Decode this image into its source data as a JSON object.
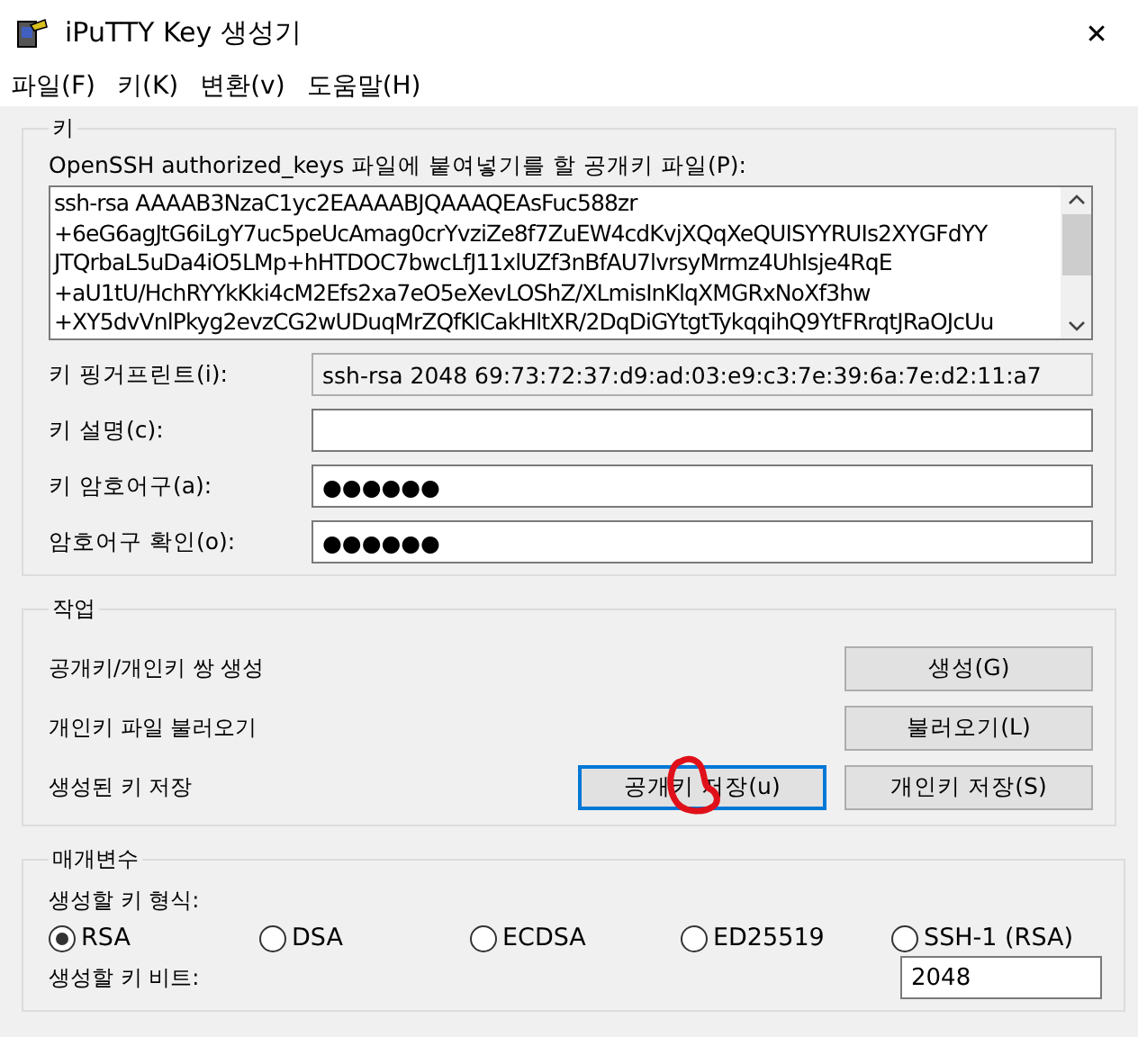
{
  "window": {
    "title": "iPuTTY Key 생성기",
    "close": "✕"
  },
  "menu": [
    "파일(F)",
    "키(K)",
    "변환(v)",
    "도움말(H)"
  ],
  "key_group": {
    "title": "키",
    "public_key_label": "OpenSSH authorized_keys 파일에 붙여넣기를 할 공개키 파일(P):",
    "public_key_lines": [
      "ssh-rsa AAAAB3NzaC1yc2EAAAABJQAAAQEAsFuc588zr",
      "+6eG6agJtG6iLgY7uc5peUcAmag0crYvziZe8f7ZuEW4cdKvjXQqXeQUISYYRUIs2XYGFdYY",
      "JTQrbaL5uDa4iO5LMp+hHTDOC7bwcLfJ11xlUZf3nBfAU7lvrsyMrmz4UhIsje4RqE",
      "+aU1tU/HchRYYkKki4cM2Efs2xa7eO5eXevLOShZ/XLmisInKlqXMGRxNoXf3hw",
      "+XY5dvVnlPkyg2evzCG2wUDuqMrZQfKlCakHltXR/2DqDiGYtgtTykqqihQ9YtFRrqtJRaOJcUu"
    ],
    "fields": [
      {
        "label": "키 핑거프린트(i):",
        "value": "ssh-rsa 2048 69:73:72:37:d9:ad:03:e9:c3:7e:39:6a:7e:d2:11:a7",
        "disabled": true
      },
      {
        "label": "키 설명(c):",
        "disabled": false
      },
      {
        "label": "키 암호어구(a):",
        "value": "●●●●●●",
        "disabled": false
      },
      {
        "label": "암호어구 확인(o):",
        "value": "●●●●●●",
        "disabled": false
      }
    ]
  },
  "actions_group": {
    "title": "작업",
    "rows": [
      {
        "label": "공개키/개인키 쌍 생성",
        "buttons": [
          {
            "label": "생성(G)",
            "focused": false
          }
        ]
      },
      {
        "label": "개인키 파일 불러오기",
        "buttons": [
          {
            "label": "불러오기(L)",
            "focused": false
          }
        ]
      },
      {
        "label": "생성된 키 저장",
        "buttons": [
          {
            "label": "공개키 저장(u)",
            "focused": true
          },
          {
            "label": "개인키 저장(S)",
            "focused": false
          }
        ]
      }
    ]
  },
  "params_group": {
    "title": "매개변수",
    "type_label": "생성할 키 형식:",
    "key_types": [
      {
        "label": "RSA",
        "selected": true
      },
      {
        "label": "DSA",
        "selected": false
      },
      {
        "label": "ECDSA",
        "selected": false
      },
      {
        "label": "ED25519",
        "selected": false
      },
      {
        "label": "SSH-1 (RSA)",
        "selected": false
      }
    ],
    "bits_label": "생성할 키 비트:",
    "bits_value": "2048"
  }
}
